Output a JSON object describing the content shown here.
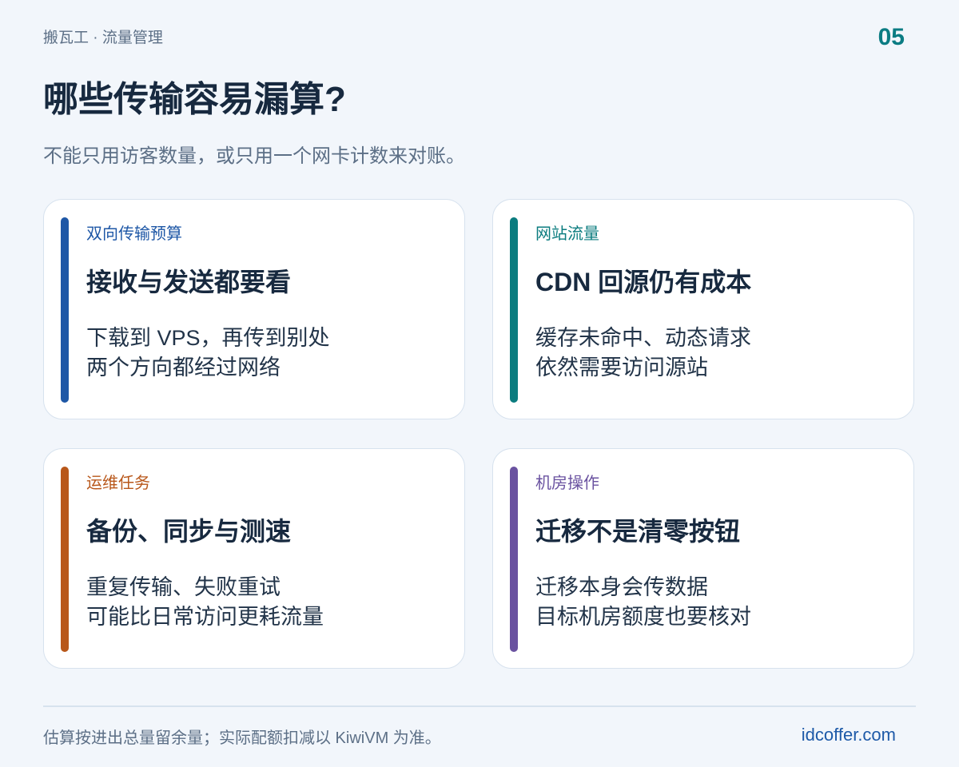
{
  "header": {
    "topline": "搬瓦工 · 流量管理",
    "page_number": "05",
    "title": "哪些传输容易漏算?",
    "subtitle": "不能只用访客数量，或只用一个网卡计数来对账。"
  },
  "cards": [
    {
      "tag": "双向传输预算",
      "heading": "接收与发送都要看",
      "line1": "下载到 VPS，再传到别处",
      "line2": "两个方向都经过网络",
      "accent": "#1e57a6",
      "tag_color": "#1e57a6"
    },
    {
      "tag": "网站流量",
      "heading": "CDN 回源仍有成本",
      "line1": "缓存未命中、动态请求",
      "line2": "依然需要访问源站",
      "accent": "#0b7c7f",
      "tag_color": "#0b7c7f"
    },
    {
      "tag": "运维任务",
      "heading": "备份、同步与测速",
      "line1": "重复传输、失败重试",
      "line2": "可能比日常访问更耗流量",
      "accent": "#b8571a",
      "tag_color": "#b8571a"
    },
    {
      "tag": "机房操作",
      "heading": "迁移不是清零按钮",
      "line1": "迁移本身会传数据",
      "line2": "目标机房额度也要核对",
      "accent": "#6a52a0",
      "tag_color": "#6a52a0"
    }
  ],
  "footer": {
    "note": "估算按进出总量留余量；实际配额扣减以 KiwiVM 为准。",
    "brand": "idcoffer.com"
  }
}
